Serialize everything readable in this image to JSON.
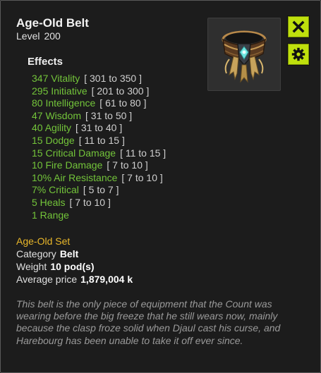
{
  "item": {
    "name": "Age-Old Belt",
    "level_label": "Level",
    "level": "200",
    "icon": "belt-item-icon"
  },
  "buttons": {
    "close_icon": "close-x-icon",
    "settings_icon": "gear-icon",
    "accent": "#bfe00d"
  },
  "effects": {
    "heading": "Effects",
    "items": [
      {
        "text": "347 Vitality",
        "range": "[ 301 to 350 ]"
      },
      {
        "text": "295 Initiative",
        "range": "[ 201 to 300 ]"
      },
      {
        "text": "80 Intelligence",
        "range": "[ 61 to 80 ]"
      },
      {
        "text": "47 Wisdom",
        "range": "[ 31 to 50 ]"
      },
      {
        "text": "40 Agility",
        "range": "[ 31 to 40 ]"
      },
      {
        "text": "15 Dodge",
        "range": "[ 11 to 15 ]"
      },
      {
        "text": "15 Critical Damage",
        "range": "[ 11 to 15 ]"
      },
      {
        "text": "10 Fire Damage",
        "range": "[ 7 to 10 ]"
      },
      {
        "text": "10% Air Resistance",
        "range": "[ 7 to 10 ]"
      },
      {
        "text": "7% Critical",
        "range": "[ 5 to 7 ]"
      },
      {
        "text": "5 Heals",
        "range": "[ 7 to 10 ]"
      },
      {
        "text": "1 Range",
        "range": ""
      }
    ],
    "color": "#73c43a"
  },
  "set": {
    "name": "Age-Old Set",
    "color": "#e9b72a"
  },
  "details": {
    "category_label": "Category",
    "category": "Belt",
    "weight_label": "Weight",
    "weight": "10 pod(s)",
    "price_label": "Average price",
    "price": "1,879,004 k"
  },
  "description": "This belt is the only piece of equipment that the Count was wearing before the big freeze that he still wears now, mainly because the clasp froze solid when Djaul cast his curse, and Harebourg has been unable to take it off ever since."
}
